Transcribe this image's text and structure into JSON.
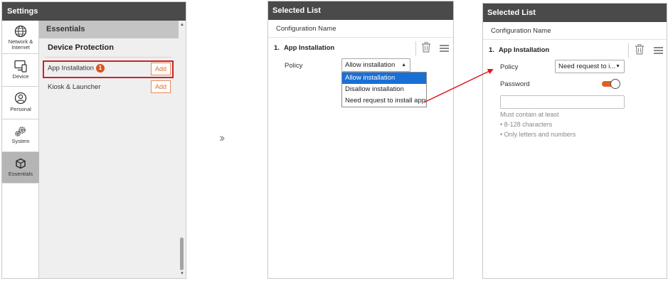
{
  "settings": {
    "title": "Settings",
    "sidebar": [
      {
        "label1": "Network &",
        "label2": "Internet",
        "icon": "globe-icon"
      },
      {
        "label1": "Device",
        "label2": "",
        "icon": "device-icon"
      },
      {
        "label1": "Personal",
        "label2": "",
        "icon": "person-icon"
      },
      {
        "label1": "System",
        "label2": "",
        "icon": "gears-icon"
      },
      {
        "label1": "Essentials",
        "label2": "",
        "icon": "box-icon",
        "selected": true
      }
    ],
    "section_title": "Essentials",
    "subsection_title": "Device Protection",
    "items": [
      {
        "label": "App Installation",
        "badge": "1",
        "add_label": "Add"
      },
      {
        "label": "Kiosk & Launcher",
        "add_label": "Add"
      }
    ]
  },
  "selected_list_before": {
    "title": "Selected List",
    "config_name_label": "Configuration Name",
    "item_number": "1.",
    "item_title": "App Installation",
    "policy_label": "Policy",
    "policy_value": "Allow installation",
    "policy_options": [
      "Allow installation",
      "Disallow installation",
      "Need request to install apps"
    ]
  },
  "selected_list_after": {
    "title": "Selected List",
    "config_name_label": "Configuration Name",
    "item_number": "1.",
    "item_title": "App Installation",
    "policy_label": "Policy",
    "policy_value": "Need request to i...",
    "password_label": "Password",
    "password_toggle_on": true,
    "password_value": "",
    "hint_title": "Must contain at least",
    "hint_rules": [
      "• 8-128 characters",
      "• Only letters and numbers"
    ]
  },
  "colors": {
    "header_bg": "#4a4a4a",
    "accent_orange": "#e0601f",
    "highlight_red": "#d21f2a",
    "selection_blue": "#1a6fd6"
  }
}
